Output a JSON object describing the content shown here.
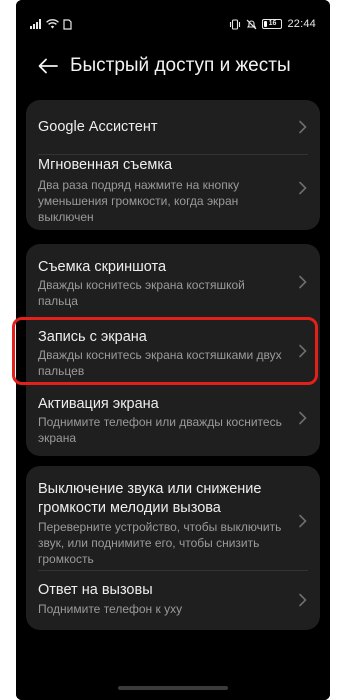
{
  "status_bar": {
    "time": "22:44",
    "battery": "16",
    "icons": [
      "signal-icon",
      "wifi-icon",
      "sim-icon",
      "vibrate-icon",
      "mute-icon"
    ]
  },
  "header": {
    "title": "Быстрый доступ и жесты"
  },
  "groups": [
    {
      "items": [
        {
          "title": "Google Ассистент"
        },
        {
          "title": "Мгновенная съемка",
          "subtitle": "Два раза подряд нажмите на кнопку уменьшения громкости, когда экран выключен"
        }
      ]
    },
    {
      "items": [
        {
          "title": "Съемка скриншота",
          "subtitle": "Дважды коснитесь экрана костяшкой пальца"
        },
        {
          "title": "Запись с экрана",
          "subtitle": "Дважды коснитесь экрана костяшками двух пальцев"
        },
        {
          "title": "Активация экрана",
          "subtitle": "Поднимите телефон или дважды коснитесь экрана"
        }
      ]
    },
    {
      "items": [
        {
          "title": "Выключение звука или снижение громкости мелодии вызова",
          "subtitle": "Переверните устройство, чтобы выключить звук, или поднимите его, чтобы снизить громкость"
        },
        {
          "title": "Ответ на вызовы",
          "subtitle": "Поднимите телефон к уху"
        }
      ]
    }
  ],
  "colors": {
    "background": "#000000",
    "card": "#1f1f1f",
    "highlight": "#e3201a"
  }
}
